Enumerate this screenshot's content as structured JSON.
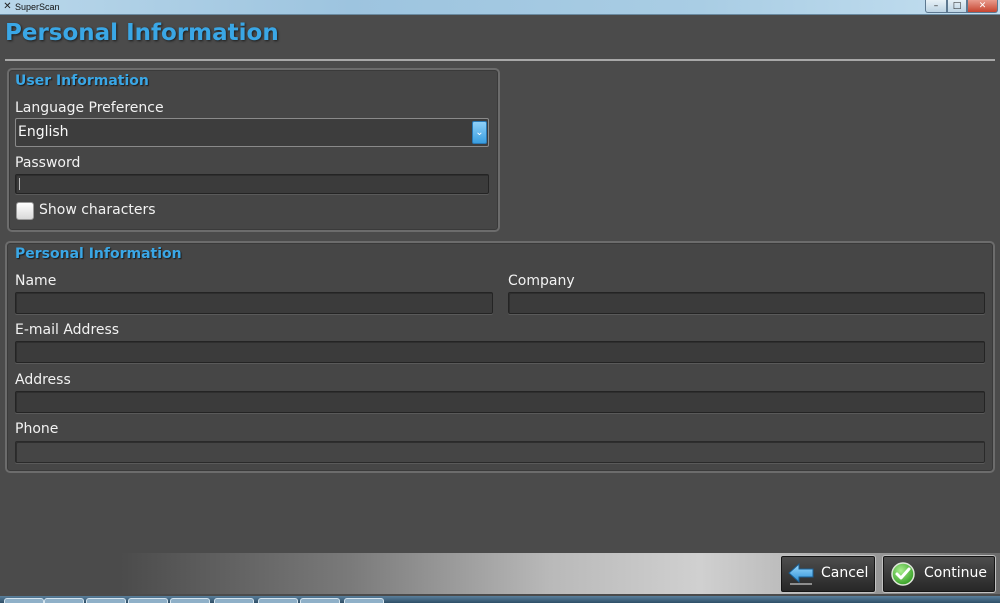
{
  "window": {
    "app_icon": "superscan-logo-icon",
    "title": "SuperScan",
    "controls": [
      "minimize-icon",
      "maximize-icon",
      "close-icon"
    ]
  },
  "page_title": "Personal Information",
  "user_info": {
    "title": "User Information",
    "language_label": "Language Preference",
    "language_value": "English",
    "password_label": "Password",
    "password_value": "",
    "show_characters_label": "Show characters",
    "show_characters_checked": false
  },
  "personal_info": {
    "title": "Personal Information",
    "name_label": "Name",
    "name_value": "",
    "company_label": "Company",
    "company_value": "",
    "email_label": "E-mail Address",
    "email_value": "",
    "address_label": "Address",
    "address_value": "",
    "phone_label": "Phone",
    "phone_value": ""
  },
  "actions": {
    "cancel_label": "Cancel",
    "continue_label": "Continue"
  },
  "colors": {
    "accent": "#3aa7e6",
    "background": "#4b4b4b",
    "continue_icon": "#3dbb2a"
  }
}
